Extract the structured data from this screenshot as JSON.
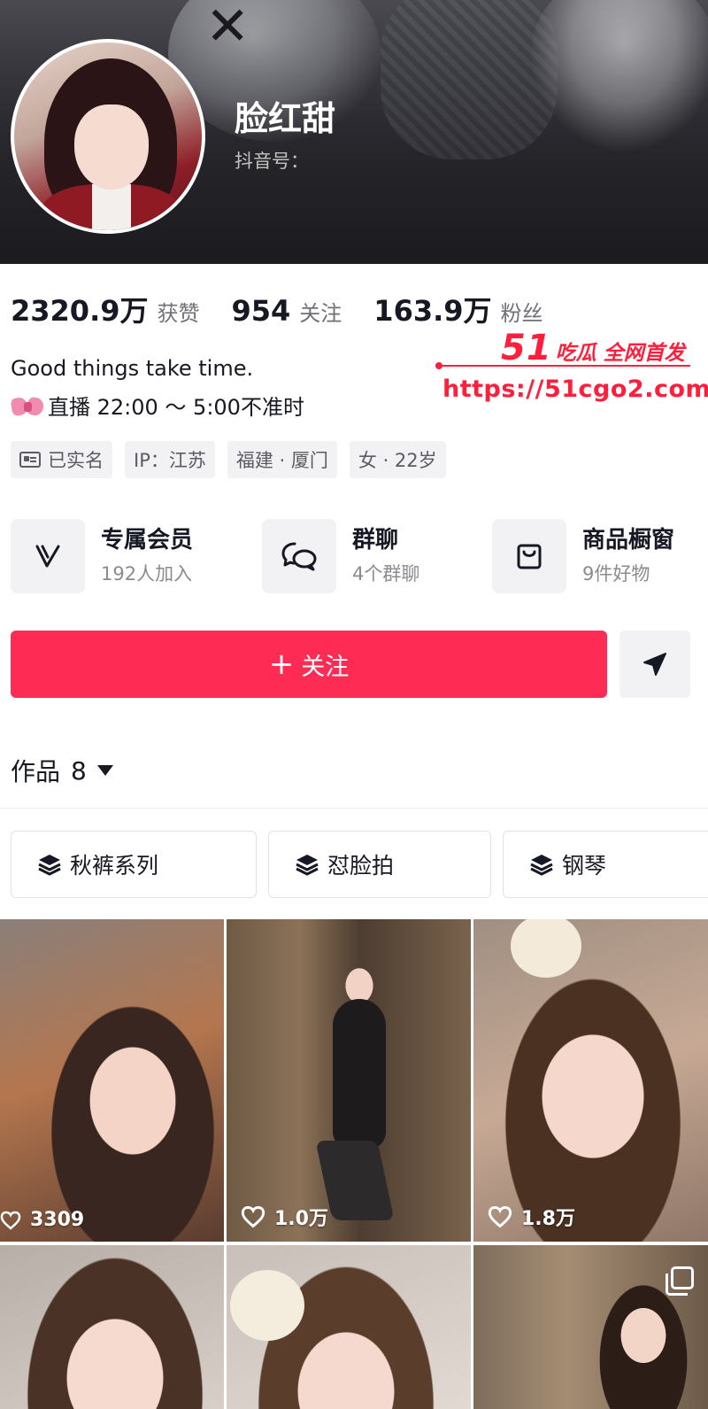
{
  "profile": {
    "name": "脸红甜",
    "id_label": "抖音号："
  },
  "stats": [
    {
      "value": "2320.9万",
      "label": "获赞"
    },
    {
      "value": "954",
      "label": "关注"
    },
    {
      "value": "163.9万",
      "label": "粉丝"
    }
  ],
  "watermark": {
    "brand_number": "51",
    "brand_text": "吃瓜 全网首发",
    "url": "https://51cgo2.com"
  },
  "bio": {
    "line1": "Good things take time.",
    "line2": "直播 22:00 ～ 5:00不准时"
  },
  "tags": [
    {
      "label": "已实名",
      "icon": "id-card-icon"
    },
    {
      "label": "IP：江苏"
    },
    {
      "label": "福建 · 厦门"
    },
    {
      "label": "女 · 22岁"
    }
  ],
  "features": [
    {
      "title": "专属会员",
      "subtitle": "192人加入",
      "icon": "membership-v-icon"
    },
    {
      "title": "群聊",
      "subtitle": "4个群聊",
      "icon": "chat-bubbles-icon"
    },
    {
      "title": "商品橱窗",
      "subtitle": "9件好物",
      "icon": "shopping-bag-icon"
    }
  ],
  "actions": {
    "follow_plus": "+",
    "follow_label": "关注",
    "share_icon": "send-arrow-icon"
  },
  "works": {
    "label": "作品",
    "count": "8"
  },
  "collections": [
    {
      "label": "秋裤系列",
      "icon": "layers-icon"
    },
    {
      "label": "怼脸拍",
      "icon": "layers-icon"
    },
    {
      "label": "钢琴",
      "icon": "layers-icon"
    }
  ],
  "videos": [
    {
      "likes": "3309"
    },
    {
      "likes": "1.0万"
    },
    {
      "likes": "1.8万"
    },
    {
      "likes": ""
    },
    {
      "likes": ""
    },
    {
      "likes": "",
      "multi_image": true
    }
  ],
  "colors": {
    "accent": "#fe2c55",
    "watermark": "#ff1f3d",
    "text_primary": "#161823",
    "text_secondary": "#8a8b91",
    "chip_bg": "#f2f2f4"
  }
}
